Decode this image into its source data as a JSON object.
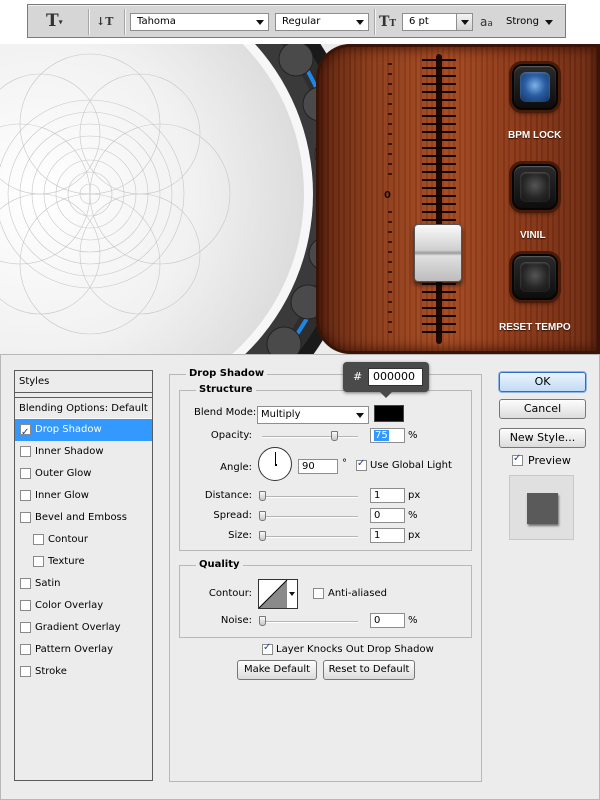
{
  "options_bar": {
    "tool_icon": "type-tool-icon",
    "orientation_icon": "text-orientation-icon",
    "font_family": "Tahoma",
    "font_style": "Regular",
    "size_icon": "font-size-icon",
    "font_size": "6 pt",
    "aa_icon": "anti-alias-icon",
    "aa_method": "Strong"
  },
  "artwork": {
    "fader_scale_label": "0",
    "buttons": [
      {
        "label": "BPM LOCK",
        "color": "#2a5fa5"
      },
      {
        "label": "VINIL",
        "color": "#262626"
      },
      {
        "label": "RESET TEMPO",
        "color": "#262626"
      }
    ],
    "accent_blue": "#1e86e6",
    "wood_color": "#9a4420"
  },
  "dialog": {
    "styles": {
      "header": "Styles",
      "blending_options": "Blending Options: Default",
      "items": [
        {
          "label": "Drop Shadow",
          "checked": true,
          "selected": true
        },
        {
          "label": "Inner Shadow",
          "checked": false
        },
        {
          "label": "Outer Glow",
          "checked": false
        },
        {
          "label": "Inner Glow",
          "checked": false
        },
        {
          "label": "Bevel and Emboss",
          "checked": false
        },
        {
          "label": "Contour",
          "checked": false
        },
        {
          "label": "Texture",
          "checked": false
        },
        {
          "label": "Satin",
          "checked": false
        },
        {
          "label": "Color Overlay",
          "checked": false
        },
        {
          "label": "Gradient Overlay",
          "checked": false
        },
        {
          "label": "Pattern Overlay",
          "checked": false
        },
        {
          "label": "Stroke",
          "checked": false
        }
      ]
    },
    "drop_shadow": {
      "title": "Drop Shadow",
      "structure_title": "Structure",
      "blend_mode_label": "Blend Mode:",
      "blend_mode": "Multiply",
      "color_tooltip_hash": "#",
      "color_hex": "000000",
      "opacity_label": "Opacity:",
      "opacity": "75",
      "opacity_fraction": 0.75,
      "angle_label": "Angle:",
      "angle": "90",
      "degree_symbol": "°",
      "use_global_light_label": "Use Global Light",
      "use_global_light": true,
      "distance_label": "Distance:",
      "distance": "1",
      "spread_label": "Spread:",
      "spread": "0",
      "size_label": "Size:",
      "size": "1",
      "unit_px": "px",
      "unit_percent": "%",
      "quality_title": "Quality",
      "contour_label": "Contour:",
      "anti_aliased_label": "Anti-aliased",
      "noise_label": "Noise:",
      "noise": "0",
      "layer_knocks_out_label": "Layer Knocks Out Drop Shadow",
      "make_default": "Make Default",
      "reset_to_default": "Reset to Default"
    },
    "buttons": {
      "ok": "OK",
      "cancel": "Cancel",
      "new_style": "New Style...",
      "preview_label": "Preview"
    }
  }
}
